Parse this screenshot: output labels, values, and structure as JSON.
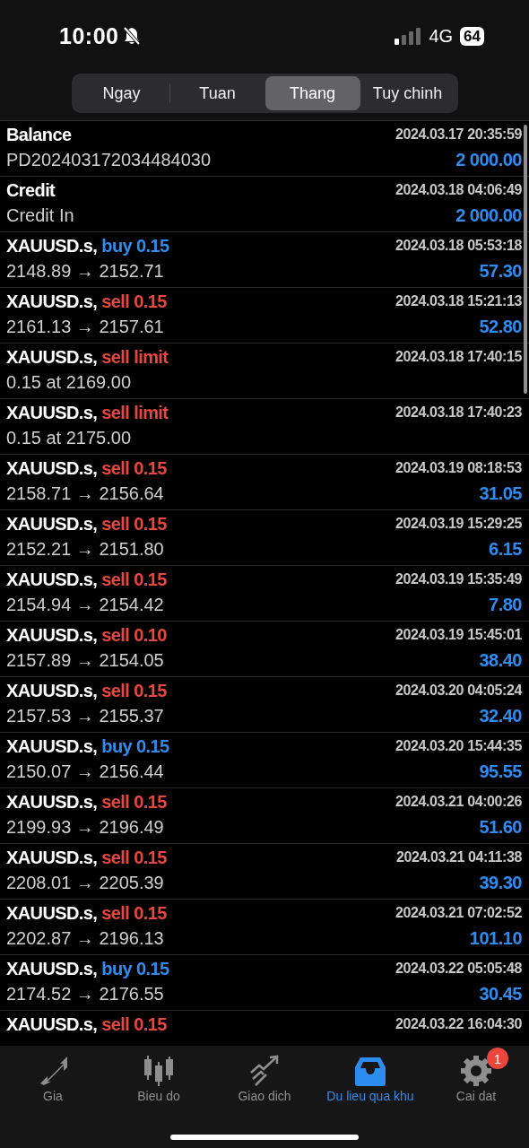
{
  "status_bar": {
    "time": "10:00",
    "network": "4G",
    "battery": "64"
  },
  "tabs": [
    {
      "label": "Ngay",
      "selected": false
    },
    {
      "label": "Tuan",
      "selected": false
    },
    {
      "label": "Thang",
      "selected": true
    },
    {
      "label": "Tuy chinh",
      "selected": false
    }
  ],
  "rows": [
    {
      "title": "Balance",
      "time": "2024.03.17 20:35:59",
      "detail": "PD20240317203448403​0",
      "amount": "2 000.00"
    },
    {
      "title": "Credit",
      "time": "2024.03.18 04:06:49",
      "detail": "Credit In",
      "amount": "2 000.00"
    },
    {
      "title": "XAUUSD.s,",
      "order": {
        "text": "buy 0.15",
        "kind": "buy"
      },
      "time": "2024.03.18 05:53:18",
      "detail": "2148.89 → 2152.71",
      "amount": "57.30"
    },
    {
      "title": "XAUUSD.s,",
      "order": {
        "text": "sell 0.15",
        "kind": "sell"
      },
      "time": "2024.03.18 15:21:13",
      "detail": "2161.13 → 2157.61",
      "amount": "52.80"
    },
    {
      "title": "XAUUSD.s,",
      "order": {
        "text": "sell limit",
        "kind": "sell"
      },
      "time": "2024.03.18 17:40:15",
      "detail": "0.15 at 2169.00"
    },
    {
      "title": "XAUUSD.s,",
      "order": {
        "text": "sell limit",
        "kind": "sell"
      },
      "time": "2024.03.18 17:40:23",
      "detail": "0.15 at 2175.00"
    },
    {
      "title": "XAUUSD.s,",
      "order": {
        "text": "sell 0.15",
        "kind": "sell"
      },
      "time": "2024.03.19 08:18:53",
      "detail": "2158.71 → 2156.64",
      "amount": "31.05"
    },
    {
      "title": "XAUUSD.s,",
      "order": {
        "text": "sell 0.15",
        "kind": "sell"
      },
      "time": "2024.03.19 15:29:25",
      "detail": "2152.21 → 2151.80",
      "amount": "6.15"
    },
    {
      "title": "XAUUSD.s,",
      "order": {
        "text": "sell 0.15",
        "kind": "sell"
      },
      "time": "2024.03.19 15:35:49",
      "detail": "2154.94 → 2154.42",
      "amount": "7.80"
    },
    {
      "title": "XAUUSD.s,",
      "order": {
        "text": "sell 0.10",
        "kind": "sell"
      },
      "time": "2024.03.19 15:45:01",
      "detail": "2157.89 → 2154.05",
      "amount": "38.40"
    },
    {
      "title": "XAUUSD.s,",
      "order": {
        "text": "sell 0.15",
        "kind": "sell"
      },
      "time": "2024.03.20 04:05:24",
      "detail": "2157.53 → 2155.37",
      "amount": "32.40"
    },
    {
      "title": "XAUUSD.s,",
      "order": {
        "text": "buy 0.15",
        "kind": "buy"
      },
      "time": "2024.03.20 15:44:35",
      "detail": "2150.07 → 2156.44",
      "amount": "95.55"
    },
    {
      "title": "XAUUSD.s,",
      "order": {
        "text": "sell 0.15",
        "kind": "sell"
      },
      "time": "2024.03.21 04:00:26",
      "detail": "2199.93 → 2196.49",
      "amount": "51.60"
    },
    {
      "title": "XAUUSD.s,",
      "order": {
        "text": "sell 0.15",
        "kind": "sell"
      },
      "time": "2024.03.21 04:11:38",
      "detail": "2208.01 → 2205.39",
      "amount": "39.30"
    },
    {
      "title": "XAUUSD.s,",
      "order": {
        "text": "sell 0.15",
        "kind": "sell"
      },
      "time": "2024.03.21 07:02:52",
      "detail": "2202.87 → 2196.13",
      "amount": "101.10"
    },
    {
      "title": "XAUUSD.s,",
      "order": {
        "text": "buy 0.15",
        "kind": "buy"
      },
      "time": "2024.03.22 05:05:48",
      "detail": "2174.52 → 2176.55",
      "amount": "30.45"
    },
    {
      "title": "XAUUSD.s,",
      "order": {
        "text": "sell 0.15",
        "kind": "sell"
      },
      "time": "2024.03.22 16:04:30"
    }
  ],
  "nav": [
    {
      "label": "Gia",
      "kind": "arrows",
      "selected": false
    },
    {
      "label": "Bieu do",
      "kind": "candles",
      "selected": false
    },
    {
      "label": "Giao dich",
      "kind": "trend",
      "selected": false
    },
    {
      "label": "Du lieu qua khu",
      "kind": "tray",
      "selected": true
    },
    {
      "label": "Cai dat",
      "kind": "gear",
      "selected": false,
      "badge": "1"
    }
  ]
}
